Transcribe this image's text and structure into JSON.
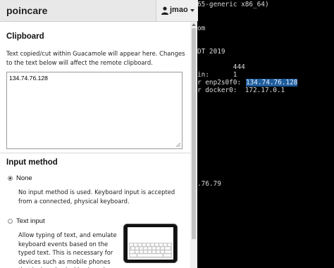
{
  "header": {
    "app_title": "poincare",
    "username": "jmao"
  },
  "clipboard": {
    "title": "Clipboard",
    "description": "Text copied/cut within Guacamole will appear here. Changes to the text below will affect the remote clipboard.",
    "value": "134.74.76.128"
  },
  "input_method": {
    "title": "Input method",
    "options": [
      {
        "label": "None",
        "selected": true,
        "description": "No input method is used. Keyboard input is accepted from a connected, physical keyboard."
      },
      {
        "label": "Text input",
        "selected": false,
        "description": "Allow typing of text, and emulate keyboard events based on the typed text. This is necessary for devices such as mobile phones that lack a physical keyboard."
      }
    ]
  },
  "terminal": {
    "lines": [
      "65-generic x86_64)",
      "om",
      "DT 2019",
      "         444",
      "in:      1",
      "r enp2s0f0:",
      "134.74.76.128",
      "r docker0:  172.17.0.1",
      ".76.79"
    ]
  },
  "colors": {
    "selection_highlight": "#1f5d9c",
    "header_bg": "#e8e8e8",
    "terminal_bg": "#000000"
  },
  "icons": [
    "user-icon",
    "chevron-down-icon",
    "resize-grip-icon",
    "tablet-keyboard-icon"
  ]
}
